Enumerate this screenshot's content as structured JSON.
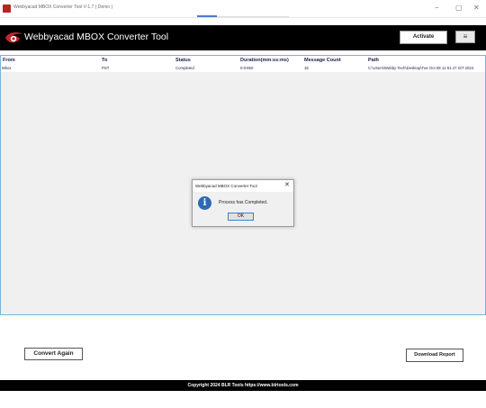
{
  "window": {
    "title": "Webbyacad MBOX Converter Tool V-1.7 ( Demo )",
    "minimize_glyph": "−",
    "maximize_glyph": "▢",
    "close_glyph": "✕"
  },
  "header": {
    "brand": "Webbyacad MBOX Converter Tool",
    "activate_label": "Activate",
    "menu_glyph": "≡"
  },
  "table": {
    "columns": [
      "From",
      "To",
      "Status",
      "Duration(mm:ss:ms)",
      "Message Count",
      "Path"
    ],
    "rows": [
      [
        "Mbox",
        "PST",
        "Completed",
        "0:0:850",
        "15",
        "C:\\Users\\Webby Tech\\Desktop\\Tue Oct 08 12 51 27 IST 2024"
      ]
    ]
  },
  "dialog": {
    "title": "Webbyacad MBOX Converter Tool",
    "message": "Process has Completed.",
    "ok_label": "OK",
    "icon_glyph": "i"
  },
  "actions": {
    "convert_again_label": "Convert Again",
    "download_report_label": "Download Report"
  },
  "footer": {
    "copyright": "Copyright 2024 BLR Tools https://www.blrtools.com"
  },
  "colors": {
    "header_bg": "#000000",
    "grid_border": "#7ab3d6",
    "info_icon": "#2e6ab3",
    "logo_red": "#c0262a"
  }
}
